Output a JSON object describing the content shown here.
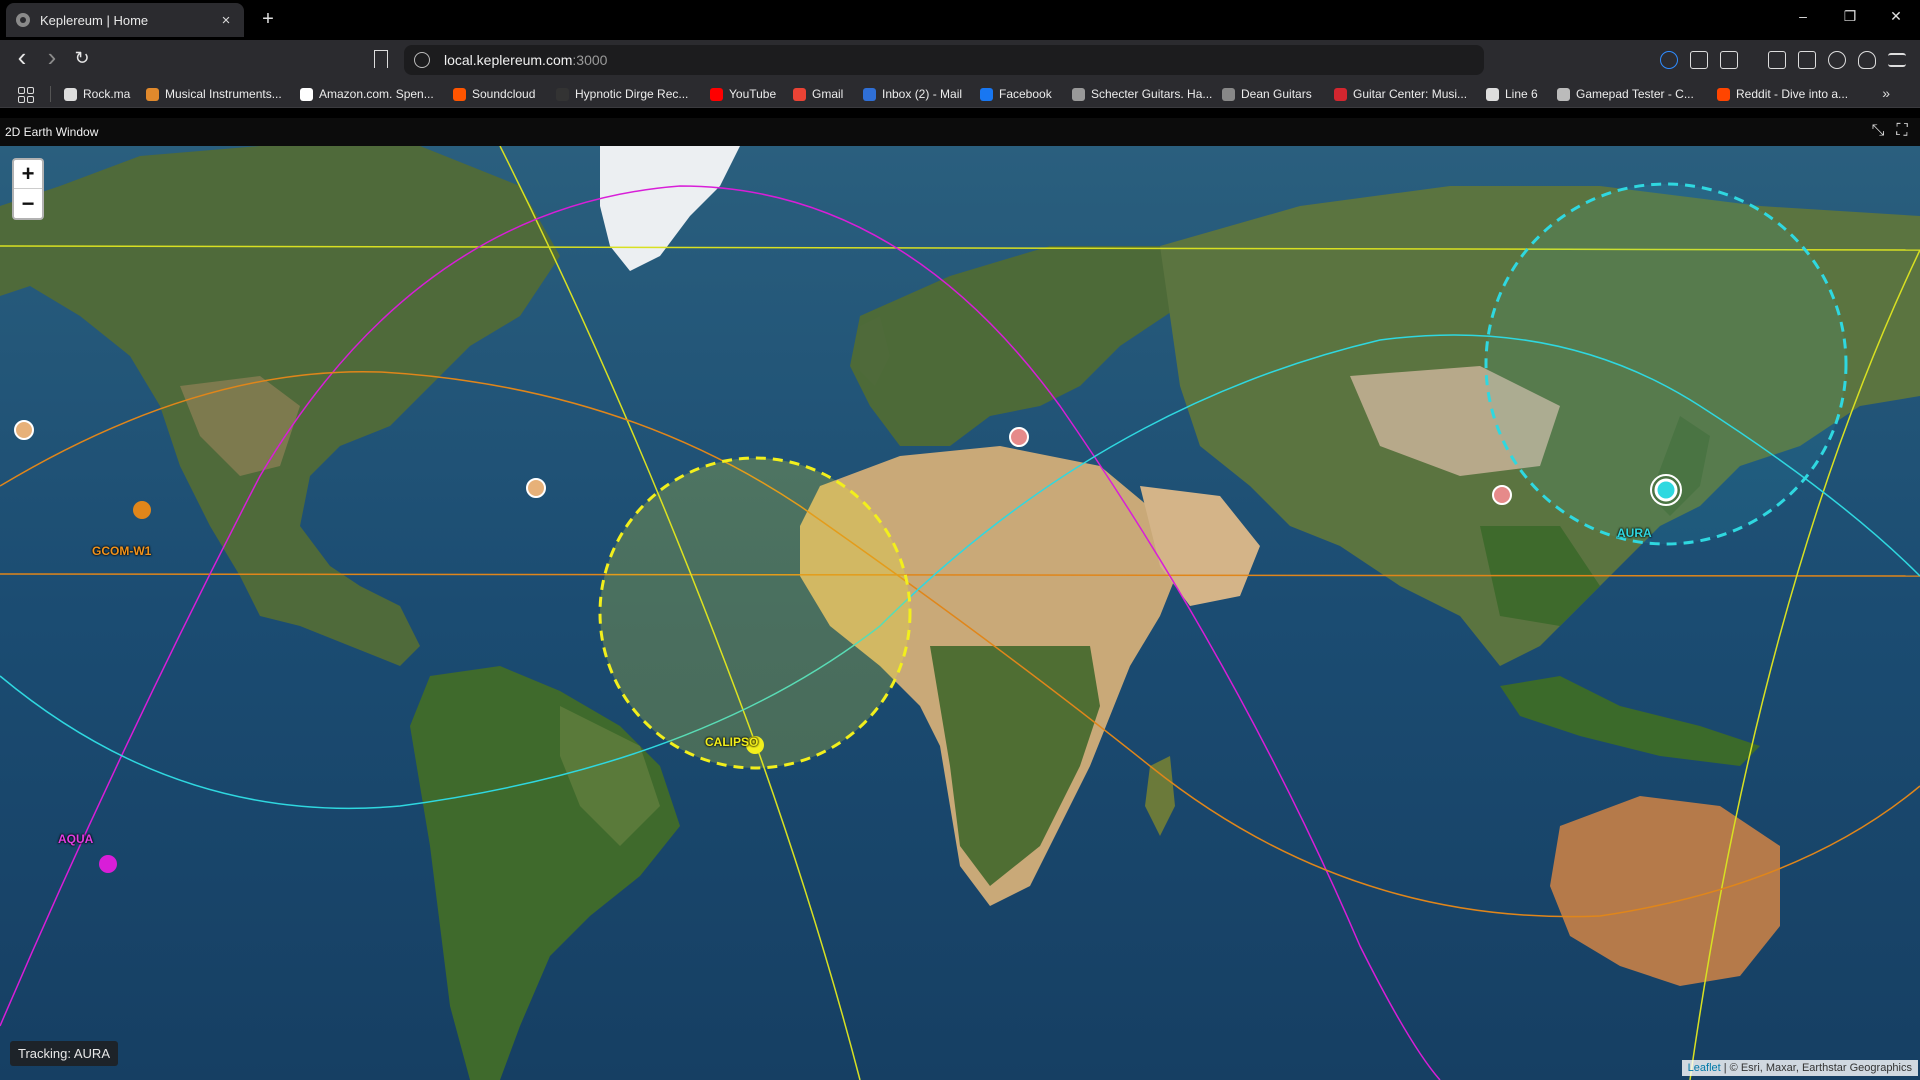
{
  "browser": {
    "tab_title": "Keplereum | Home",
    "tab_close": "×",
    "new_tab": "+",
    "window_controls": {
      "minimize": "–",
      "restore": "❐",
      "close": "✕"
    },
    "nav": {
      "back": "‹",
      "forward": "›",
      "reload": "↻"
    },
    "url_host": "local.keplereum.com",
    "url_port": ":3000",
    "bookmarks": [
      {
        "label": "Rock.ma",
        "color": "#dddddd"
      },
      {
        "label": "Musical Instruments...",
        "color": "#e0892c"
      },
      {
        "label": "Amazon.com. Spen...",
        "color": "#ffffff"
      },
      {
        "label": "Soundcloud",
        "color": "#ff5500"
      },
      {
        "label": "Hypnotic Dirge Rec...",
        "color": "#333333"
      },
      {
        "label": "YouTube",
        "color": "#ff0000"
      },
      {
        "label": "Gmail",
        "color": "#ea4335"
      },
      {
        "label": "Inbox (2) - Mail",
        "color": "#2f6fd6"
      },
      {
        "label": "Facebook",
        "color": "#1877f2"
      },
      {
        "label": "Schecter Guitars. Ha...",
        "color": "#999999"
      },
      {
        "label": "Dean Guitars",
        "color": "#888888"
      },
      {
        "label": "Guitar Center: Musi...",
        "color": "#d3262f"
      },
      {
        "label": "Line 6",
        "color": "#dddddd"
      },
      {
        "label": "Gamepad Tester - C...",
        "color": "#bbbbbb"
      },
      {
        "label": "Reddit - Dive into a...",
        "color": "#ff4500"
      }
    ],
    "bookmarks_more": "»"
  },
  "app": {
    "window_title": "2D Earth Window",
    "exit_fullscreen_icon": "⤡",
    "fullscreen_icon": "⛶"
  },
  "map": {
    "zoom_in": "+",
    "zoom_out": "−",
    "tracking_label": "Tracking: AURA",
    "attribution_leaflet": "Leaflet",
    "attribution_rest": " | © Esri, Maxar, Earthstar Geographics",
    "satellites": [
      {
        "name": "AURA",
        "color": "#2fd8e0",
        "tracked": true
      },
      {
        "name": "CALIPSO",
        "color": "#f2ef1c",
        "tracked": false
      },
      {
        "name": "GCOM-W1",
        "color": "#e0861a",
        "tracked": false
      },
      {
        "name": "AQUA",
        "color": "#d81ed8",
        "tracked": false
      }
    ]
  }
}
